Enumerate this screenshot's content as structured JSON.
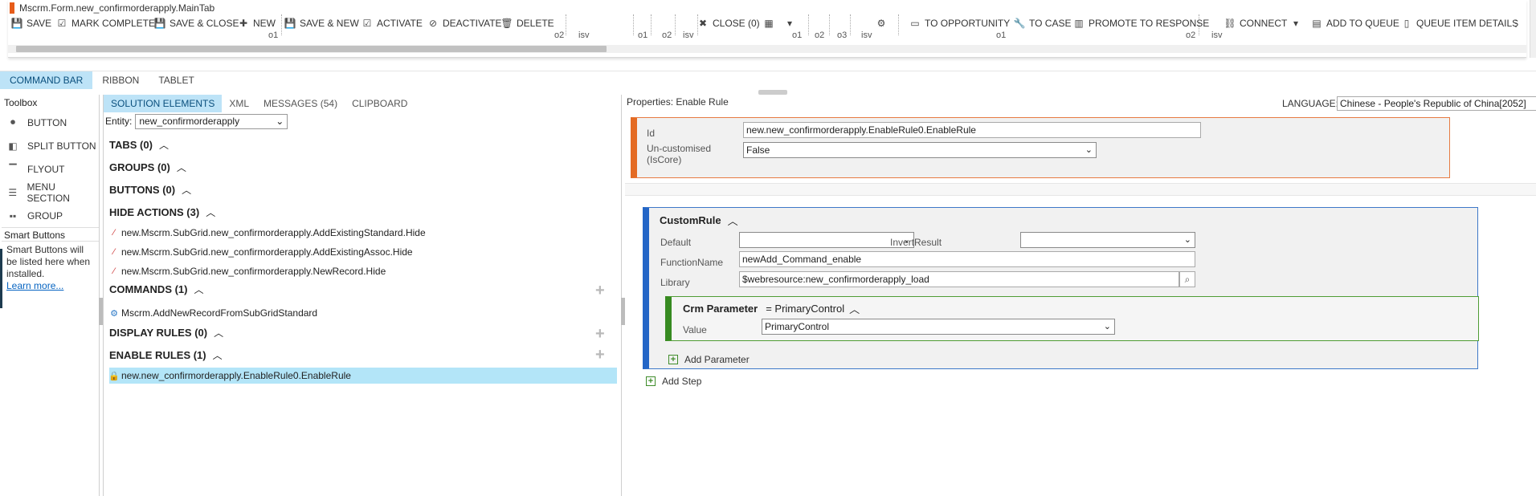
{
  "ribbon": {
    "tab_title": "Mscrm.Form.new_confirmorderapply.MainTab",
    "buttons": {
      "save": "SAVE",
      "mark_complete": "MARK COMPLETE",
      "save_close": "SAVE & CLOSE",
      "new": "NEW",
      "save_new": "SAVE & NEW",
      "activate": "ACTIVATE",
      "deactivate": "DEACTIVATE",
      "delete": "DELETE",
      "close": "CLOSE (0)",
      "to_opportunity": "TO OPPORTUNITY",
      "to_case": "TO CASE",
      "promote": "PROMOTE TO RESPONSE",
      "connect": "CONNECT",
      "add_to_queue": "ADD TO QUEUE",
      "queue_item_details": "QUEUE ITEM DETAILS"
    },
    "slots": {
      "s1": "o1",
      "s2": "o2",
      "s3": "isv",
      "s4": "o1",
      "s5": "o2",
      "s6": "isv",
      "s7": "o1",
      "s8": "o2",
      "s9": "o3",
      "s10": "isv",
      "s11": "o1",
      "s12": "o2",
      "s13": "isv"
    }
  },
  "mode_tabs": [
    "COMMAND BAR",
    "RIBBON",
    "TABLET"
  ],
  "toolbox": {
    "title": "Toolbox",
    "items": [
      "BUTTON",
      "SPLIT BUTTON",
      "FLYOUT",
      "MENU SECTION",
      "GROUP"
    ],
    "smart_title": "Smart Buttons",
    "smart_text": "Smart Buttons will be listed here when installed.",
    "smart_link": "Learn more..."
  },
  "solution": {
    "tabs": [
      "SOLUTION ELEMENTS",
      "XML",
      "MESSAGES (54)",
      "CLIPBOARD"
    ],
    "entity_label": "Entity:",
    "entity_value": "new_confirmorderapply",
    "sections": {
      "tabs": "TABS (0)",
      "groups": "GROUPS (0)",
      "buttons": "BUTTONS (0)",
      "hide_actions": "HIDE ACTIONS (3)",
      "commands": "COMMANDS (1)",
      "display_rules": "DISPLAY RULES (0)",
      "enable_rules": "ENABLE RULES (1)"
    },
    "hide_actions": [
      "new.Mscrm.SubGrid.new_confirmorderapply.AddExistingStandard.Hide",
      "new.Mscrm.SubGrid.new_confirmorderapply.AddExistingAssoc.Hide",
      "new.Mscrm.SubGrid.new_confirmorderapply.NewRecord.Hide"
    ],
    "commands": [
      "Mscrm.AddNewRecordFromSubGridStandard"
    ],
    "enable_rules": [
      "new.new_confirmorderapply.EnableRule0.EnableRule"
    ]
  },
  "properties": {
    "title": "Properties: Enable Rule",
    "language_label": "LANGUAGE:",
    "language_value": "Chinese - People's Republic of China[2052]",
    "id_label": "Id",
    "id_value": "new.new_confirmorderapply.EnableRule0.EnableRule",
    "uncustomised_label": "Un-customised (IsCore)",
    "uncustomised_value": "False",
    "rule": {
      "title": "CustomRule",
      "default_label": "Default",
      "default_value": "",
      "invert_label": "InvertResult",
      "invert_value": "",
      "function_label": "FunctionName",
      "function_value": "newAdd_Command_enable",
      "library_label": "Library",
      "library_value": "$webresource:new_confirmorderapply_load",
      "param_title": "Crm Parameter",
      "param_eq": "= PrimaryControl",
      "param_value_label": "Value",
      "param_value": "PrimaryControl",
      "add_parameter": "Add Parameter"
    },
    "add_step": "Add Step"
  },
  "colors": {
    "accent_blue": "#bde3f7",
    "id_border": "#e46b24",
    "rule_border": "#2466c7",
    "param_border": "#378a21"
  }
}
